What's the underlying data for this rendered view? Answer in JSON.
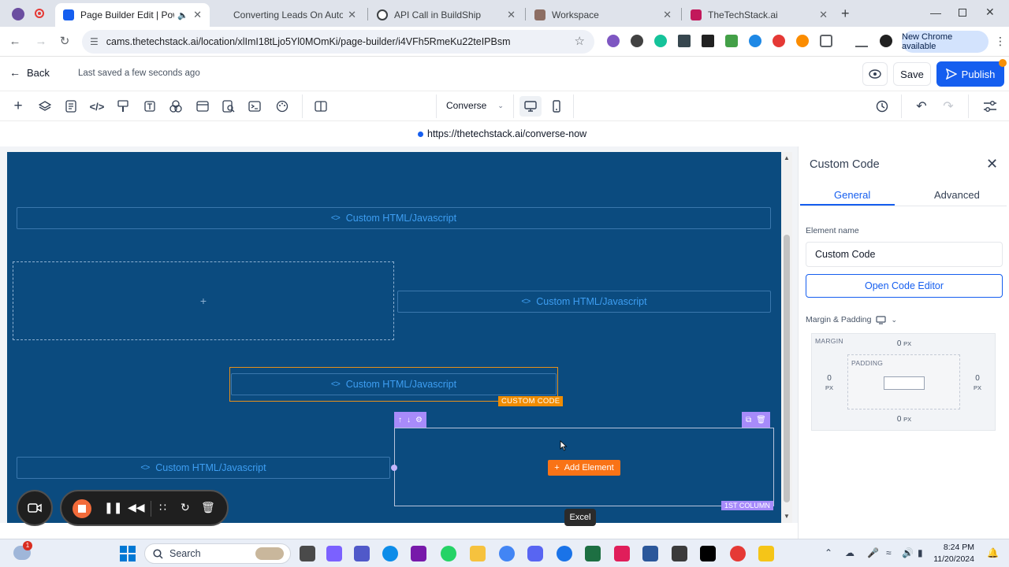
{
  "browser": {
    "tabs": [
      {
        "label": "Page Builder Edit | Powerho",
        "active": true
      },
      {
        "label": "Converting Leads On Autopilot",
        "active": false
      },
      {
        "label": "API Call in BuildShip",
        "active": false
      },
      {
        "label": "Workspace",
        "active": false
      },
      {
        "label": "TheTechStack.ai",
        "active": false
      }
    ],
    "url": "cams.thetechstack.ai/location/xlImI18tLjo5Yl0MOmKi/page-builder/i4VFh5RmeKu22teIPBsm",
    "new_chrome_label": "New Chrome available"
  },
  "header": {
    "back_label": "Back",
    "saved_status": "Last saved a few seconds ago",
    "save_label": "Save",
    "publish_label": "Publish"
  },
  "toolbar": {
    "page_selector": "Converse"
  },
  "preview_url": "https://thetechstack.ai/converse-now",
  "canvas": {
    "element_label": "Custom HTML/Javascript",
    "custom_code_badge": "CUSTOM CODE",
    "column_badge": "1ST COLUMN",
    "add_element_label": "Add Element",
    "add_placeholder": "+"
  },
  "tooltip": "Excel",
  "panel": {
    "title": "Custom Code",
    "tabs": {
      "general": "General",
      "advanced": "Advanced"
    },
    "element_name_label": "Element name",
    "element_name_value": "Custom Code",
    "open_code_editor_label": "Open Code Editor",
    "margin_padding_label": "Margin & Padding",
    "margin_label": "MARGIN",
    "padding_label": "PADDING",
    "margin": {
      "top": "0",
      "right": "0",
      "bottom": "0",
      "left": "0"
    },
    "unit": "PX"
  },
  "taskbar": {
    "search_label": "Search",
    "time": "8:24 PM",
    "date": "11/20/2024",
    "notification_count": "1"
  },
  "colors": {
    "canvas_bg": "#0b4b7f",
    "accent_blue": "#155eef",
    "selection_orange": "#f08c00",
    "column_purple": "#a78bfa"
  }
}
